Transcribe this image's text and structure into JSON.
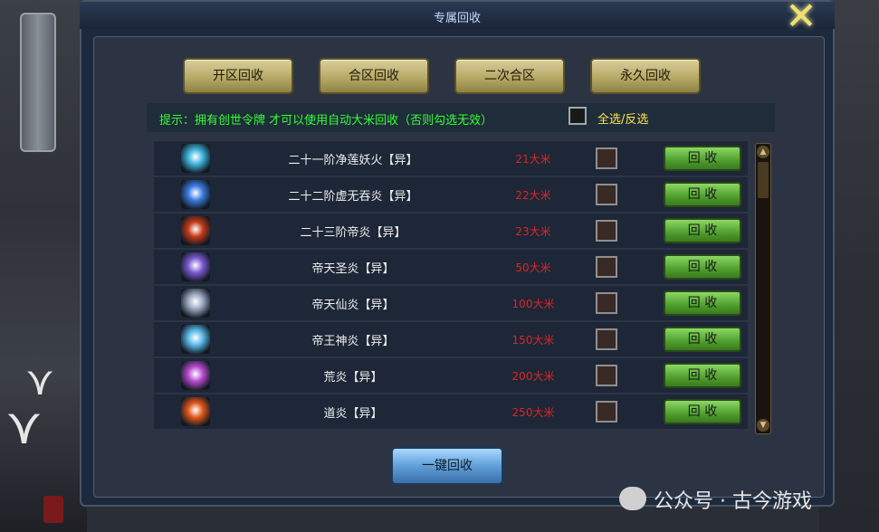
{
  "window": {
    "title": "专属回收"
  },
  "tabs": [
    {
      "label": "开区回收"
    },
    {
      "label": "合区回收"
    },
    {
      "label": "二次合区"
    },
    {
      "label": "永久回收"
    }
  ],
  "tip": {
    "text": "提示：拥有创世令牌 才可以使用自动大米回收（否则勾选无效）"
  },
  "select_all": {
    "label": "全选/反选"
  },
  "items": [
    {
      "name": "二十一阶净莲妖火【异】",
      "price": "21大米",
      "action": "回 收",
      "icon": "cyan-flame-icon",
      "icon_color": "#3fb3d9"
    },
    {
      "name": "二十二阶虚无吞炎【异】",
      "price": "22大米",
      "action": "回 收",
      "icon": "blue-vortex-icon",
      "icon_color": "#3c7ae0"
    },
    {
      "name": "二十三阶帝炎【异】",
      "price": "23大米",
      "action": "回 收",
      "icon": "red-demon-icon",
      "icon_color": "#c43a1a"
    },
    {
      "name": "帝天圣炎【异】",
      "price": "50大米",
      "action": "回 收",
      "icon": "purple-orb-icon",
      "icon_color": "#7a5ad0"
    },
    {
      "name": "帝天仙炎【异】",
      "price": "100大米",
      "action": "回 收",
      "icon": "silver-crest-icon",
      "icon_color": "#9aa8c0"
    },
    {
      "name": "帝王神炎【异】",
      "price": "150大米",
      "action": "回 收",
      "icon": "ice-crystal-icon",
      "icon_color": "#5ab8e8"
    },
    {
      "name": "荒炎【异】",
      "price": "200大米",
      "action": "回 收",
      "icon": "violet-spirit-icon",
      "icon_color": "#b84ad0"
    },
    {
      "name": "道炎【异】",
      "price": "250大米",
      "action": "回 收",
      "icon": "fire-orb-icon",
      "icon_color": "#e0561a"
    }
  ],
  "footer": {
    "onekey_label": "一键回收"
  },
  "watermark": {
    "text": "公众号 · 古今游戏"
  }
}
